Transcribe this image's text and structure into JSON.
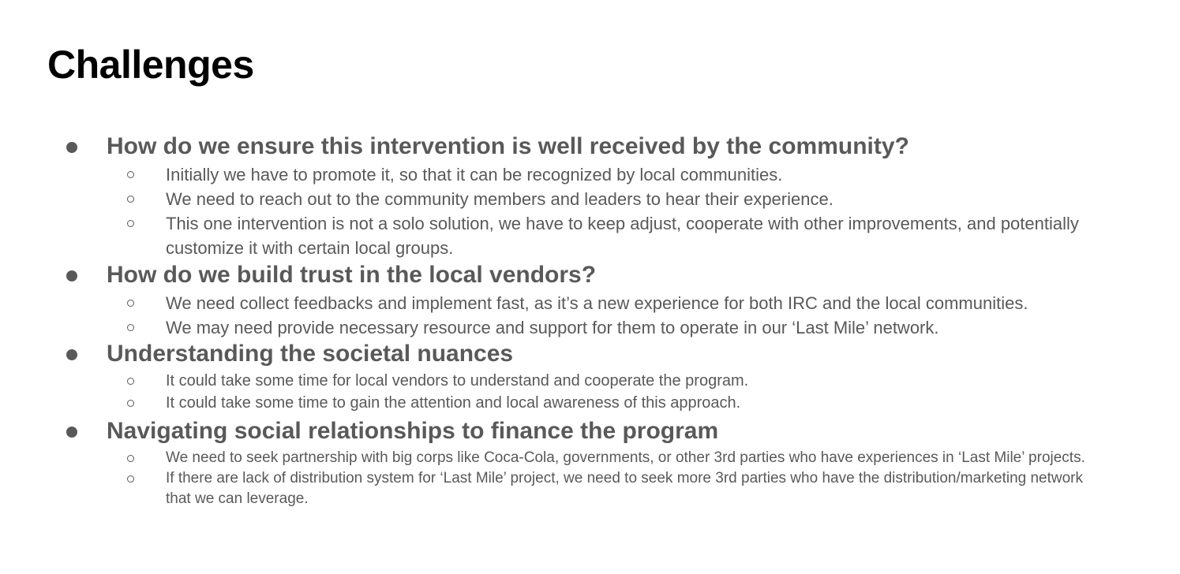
{
  "slide": {
    "title": "Challenges",
    "bullets": [
      {
        "heading": "How do we ensure this intervention is well received by the community?",
        "subs": [
          "Initially we have to promote it, so that it can be recognized by local communities.",
          "We need to reach out to the community members and leaders to hear their experience.",
          "This one intervention is not a solo solution, we have to keep adjust, cooperate with other improvements, and potentially customize it with certain local groups."
        ]
      },
      {
        "heading": "How do we build trust in the local vendors?",
        "subs": [
          "We need collect feedbacks and implement fast, as it’s a new experience for both IRC and the local communities.",
          "We may need provide necessary resource and support for them to operate in our ‘Last Mile’ network."
        ]
      },
      {
        "heading": "Understanding the societal nuances",
        "subs": [
          "It could take some time for local vendors to understand and cooperate the program.",
          "It could take some time to gain the attention and local awareness of this approach."
        ]
      },
      {
        "heading": "Navigating social relationships to finance the program",
        "subs": [
          "We need to seek partnership with big corps like Coca-Cola, governments, or other 3rd parties who have experiences in ‘Last Mile’ projects.",
          "If there are lack of distribution system for ‘Last Mile’ project, we need to seek more 3rd parties who have the distribution/marketing network that we can leverage."
        ]
      }
    ]
  }
}
